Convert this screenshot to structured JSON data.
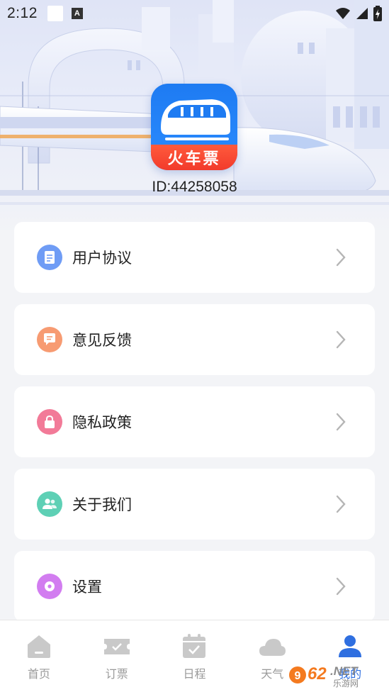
{
  "status_bar": {
    "time": "2:12",
    "a_glyph": "A"
  },
  "app": {
    "logo_text": "火车票",
    "user_id": "ID:44258058"
  },
  "menu": {
    "items": [
      {
        "label": "用户协议",
        "icon": "document-icon",
        "color": "#6f9cf5"
      },
      {
        "label": "意见反馈",
        "icon": "feedback-icon",
        "color": "#f79b72"
      },
      {
        "label": "隐私政策",
        "icon": "lock-icon",
        "color": "#f27a98"
      },
      {
        "label": "关于我们",
        "icon": "people-icon",
        "color": "#5ed0b5"
      },
      {
        "label": "设置",
        "icon": "settings-icon",
        "color": "#d27df0"
      }
    ]
  },
  "nav": {
    "items": [
      {
        "label": "首页",
        "icon": "home-icon"
      },
      {
        "label": "订票",
        "icon": "ticket-icon"
      },
      {
        "label": "日程",
        "icon": "calendar-icon"
      },
      {
        "label": "天气",
        "icon": "cloud-icon"
      },
      {
        "label": "我的",
        "icon": "user-icon",
        "active": true
      }
    ]
  },
  "watermark": {
    "text": "962.NET",
    "sub": "乐游网"
  },
  "colors": {
    "accent": "#2f6fe0",
    "logo_blue": "#1e7bf2",
    "logo_red": "#f23b2b"
  }
}
